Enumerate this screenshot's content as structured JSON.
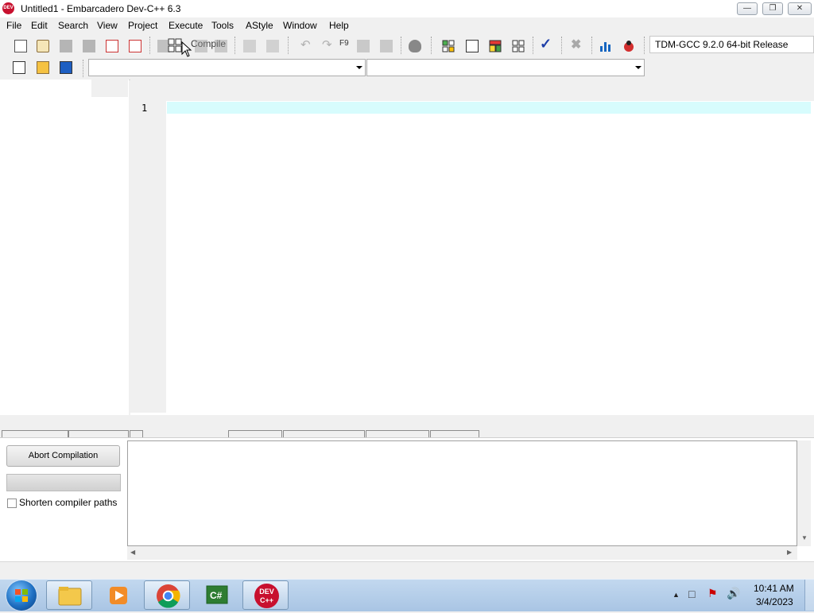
{
  "window": {
    "title": "Untitled1 - Embarcadero Dev-C++ 6.3",
    "app_icon_text": "DEV C++",
    "minimize": "minimize-icon",
    "restore": "restore-icon",
    "close": "close-icon"
  },
  "menu": [
    "File",
    "Edit",
    "Search",
    "View",
    "Project",
    "Execute",
    "Tools",
    "AStyle",
    "Window",
    "Help"
  ],
  "toolbar": {
    "compile_tooltip": "Compile",
    "compile_shortcut": "F9",
    "compiler_profile": "TDM-GCC 9.2.0 64-bit Release",
    "class_combo_value": "",
    "member_combo_value": ""
  },
  "editor": {
    "line_numbers": [
      "1"
    ],
    "code_lines": [
      ""
    ]
  },
  "bottom_panel": {
    "abort_label": "Abort Compilation",
    "shorten_label": "Shorten compiler paths",
    "shorten_checked": false,
    "progress": 0
  },
  "taskbar": {
    "time": "10:41 AM",
    "date": "3/4/2023",
    "apps": [
      "windows-explorer",
      "media-player",
      "google-chrome",
      "csharp-app",
      "dev-cpp"
    ],
    "dev_icon_text": "DEV C++"
  },
  "colors": {
    "current_line_highlight": "#d7fcfd",
    "dev_brand": "#c8102e"
  }
}
